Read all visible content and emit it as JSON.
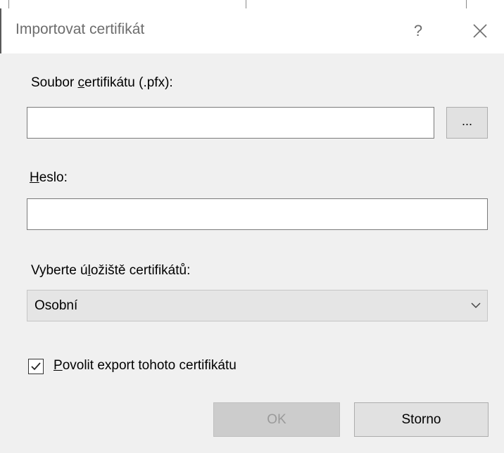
{
  "dialog": {
    "title": "Importovat certifikát",
    "help_label": "?"
  },
  "cert_file": {
    "label_before": "Soubor ",
    "label_accel": "c",
    "label_after": "ertifikátu (.pfx):",
    "value": "",
    "browse_label": "..."
  },
  "password": {
    "label_accel": "H",
    "label_after": "eslo:",
    "value": ""
  },
  "store": {
    "label_before": "Vyberte ú",
    "label_accel": "l",
    "label_after": "ožiště certifikátů:",
    "selected": "Osobní"
  },
  "export": {
    "checked": true,
    "label_accel": "P",
    "label_after": "ovolit export tohoto certifikátu"
  },
  "buttons": {
    "ok": "OK",
    "cancel": "Storno"
  }
}
